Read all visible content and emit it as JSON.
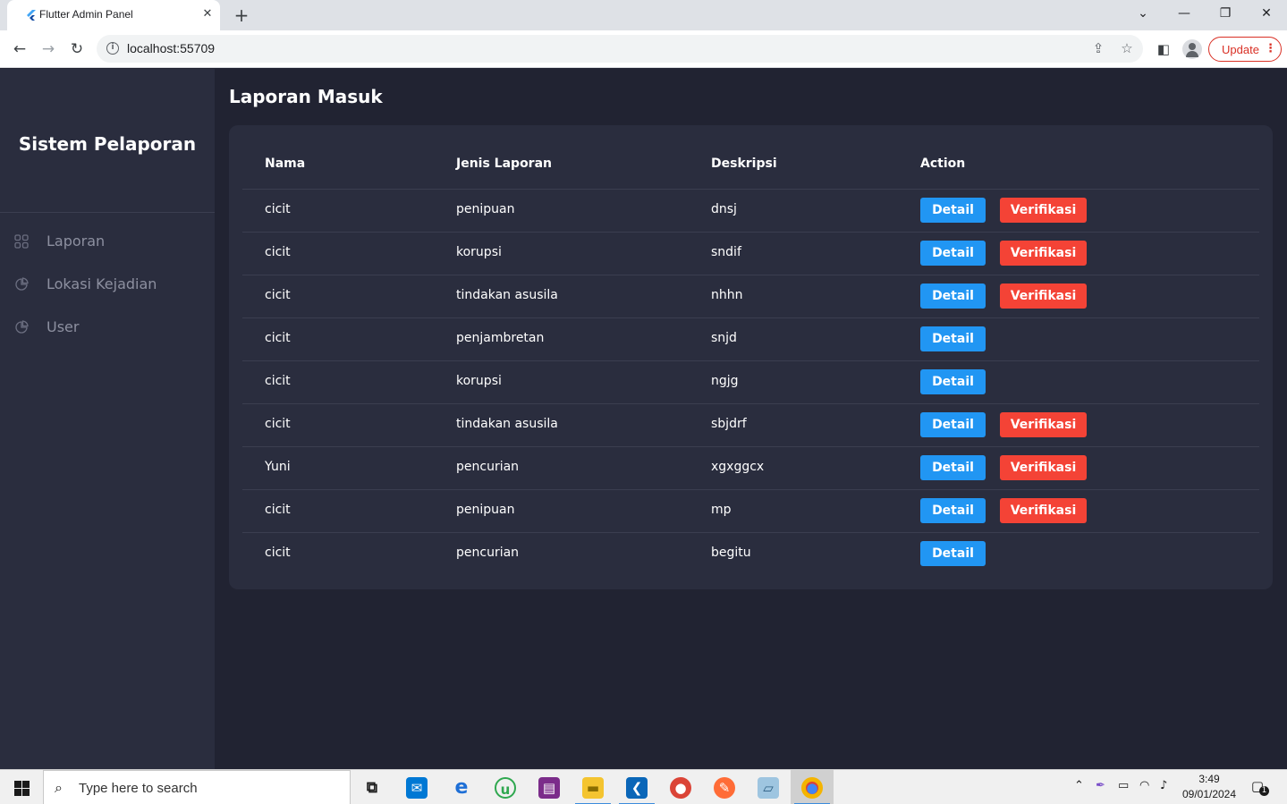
{
  "browser": {
    "tab_title": "Flutter Admin Panel",
    "url": "localhost:55709",
    "update_label": "Update"
  },
  "sidebar": {
    "brand": "Sistem Pelaporan",
    "items": [
      {
        "label": "Laporan",
        "icon": "dashboard-grid-icon"
      },
      {
        "label": "Lokasi Kejadian",
        "icon": "pie-chart-icon"
      },
      {
        "label": "User",
        "icon": "pie-chart-icon"
      }
    ]
  },
  "main": {
    "title": "Laporan Masuk",
    "table": {
      "headers": [
        "Nama",
        "Jenis Laporan",
        "Deskripsi",
        "Action"
      ],
      "detail_label": "Detail",
      "verify_label": "Verifikasi",
      "rows": [
        {
          "nama": "cicit",
          "jenis": "penipuan",
          "deskripsi": "dnsj",
          "verifikasi": true
        },
        {
          "nama": "cicit",
          "jenis": "korupsi",
          "deskripsi": "sndif",
          "verifikasi": true
        },
        {
          "nama": "cicit",
          "jenis": "tindakan asusila",
          "deskripsi": "nhhn",
          "verifikasi": true
        },
        {
          "nama": "cicit",
          "jenis": "penjambretan",
          "deskripsi": "snjd",
          "verifikasi": false
        },
        {
          "nama": "cicit",
          "jenis": "korupsi",
          "deskripsi": "ngjg",
          "verifikasi": false
        },
        {
          "nama": "cicit",
          "jenis": "tindakan asusila",
          "deskripsi": "sbjdrf",
          "verifikasi": true
        },
        {
          "nama": "Yuni",
          "jenis": "pencurian",
          "deskripsi": "xgxggcx",
          "verifikasi": true
        },
        {
          "nama": "cicit",
          "jenis": "penipuan",
          "deskripsi": "mp",
          "verifikasi": true
        },
        {
          "nama": "cicit",
          "jenis": "pencurian",
          "deskripsi": "begitu",
          "verifikasi": false
        }
      ]
    }
  },
  "taskbar": {
    "search_placeholder": "Type here to search",
    "time": "3:49",
    "date": "09/01/2024",
    "notification_count": "1"
  },
  "colors": {
    "background": "#212332",
    "panel": "#2a2d3e",
    "detail_button": "#2196f3",
    "verify_button": "#f44336"
  }
}
